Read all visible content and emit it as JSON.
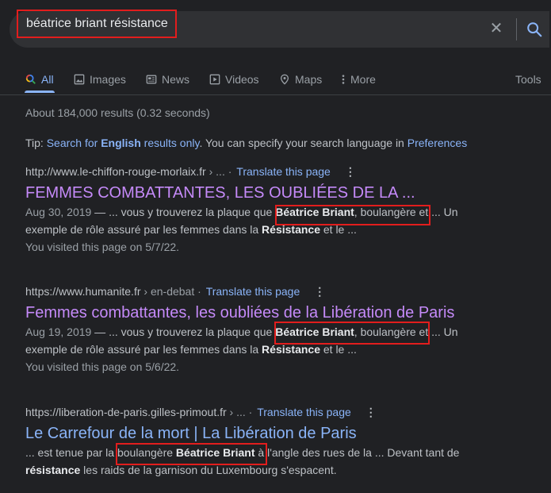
{
  "search": {
    "query": "béatrice briant résistance"
  },
  "tabs": [
    {
      "label": "All",
      "icon": "google-search-icon",
      "active": true
    },
    {
      "label": "Images",
      "icon": "image-icon"
    },
    {
      "label": "News",
      "icon": "news-icon"
    },
    {
      "label": "Videos",
      "icon": "play-icon"
    },
    {
      "label": "Maps",
      "icon": "map-pin-icon"
    },
    {
      "label": "More",
      "icon": "more-vertical-icon"
    },
    {
      "label": "Tools"
    }
  ],
  "stats": "About 184,000 results (0.32 seconds)",
  "tip": {
    "prefix": "Tip: ",
    "link1": "Search for ",
    "link1_bold": "English",
    "link1_suffix": " results only",
    "middle": ". You can specify your search language in ",
    "link2": "Preferences"
  },
  "results": [
    {
      "url_main": "http://www.le-chiffon-rouge-morlaix.fr",
      "url_path": " › ...",
      "translate": "Translate this page",
      "title": "FEMMES COMBATTANTES, LES OUBLIÉES DE LA ...",
      "date": "Aug 30, 2019",
      "s1": " — ... vous y trouverez la plaque que ",
      "b1": "Béatrice Briant",
      "s2": ", boulangère et ... Un",
      "s3": "exemple de rôle assuré par les femmes dans la ",
      "b2": "Résistance",
      "s4": " et le ...",
      "visited": "You visited this page on 5/7/22."
    },
    {
      "url_main": "https://www.humanite.fr",
      "url_path": " › en-debat",
      "translate": "Translate this page",
      "title": "Femmes combattantes, les oubliées de la Libération de Paris",
      "date": "Aug 19, 2019",
      "s1": " — ... vous y trouverez la plaque que ",
      "b1": "Béatrice Briant",
      "s2": ", boulangère et ... Un",
      "s3": "exemple de rôle assuré par les femmes dans la ",
      "b2": "Résistance",
      "s4": " et le ...",
      "visited": "You visited this page on 5/6/22."
    },
    {
      "url_main": "https://liberation-de-paris.gilles-primout.fr",
      "url_path": " › ...",
      "translate": "Translate this page",
      "title": "Le Carrefour de la mort | La Libération de Paris",
      "s1": "... est tenue par la boulangère ",
      "b1": "Béatrice Briant",
      "s2": " à l'angle des rues de la ... Devant tant de",
      "b2": "résistance",
      "s3": " les raids de la garnison du Luxembourg s'espacent."
    }
  ],
  "colors": {
    "highlight_box": "#e21d1d",
    "link": "#8ab4f8",
    "visited_title": "#c58af9"
  }
}
